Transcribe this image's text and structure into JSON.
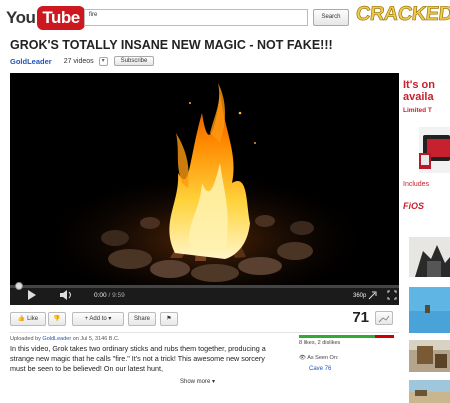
{
  "header": {
    "logo_you": "You",
    "logo_tube": "Tube",
    "search_value": "fire",
    "search_button": "Search",
    "cracked_logo": "CRACKED.com"
  },
  "video": {
    "title": "GROK'S TOTALLY INSANE NEW MAGIC - NOT FAKE!!!",
    "channel": "GoldLeader",
    "video_count": "27 videos",
    "subscribe": "Subscribe"
  },
  "player": {
    "current_time": "0:00",
    "duration": "/ 9:59",
    "quality": "360p",
    "progress_fraction": 0.0
  },
  "actions": {
    "like": "Like",
    "add_to": "+  Add to",
    "share": "Share",
    "views": "71"
  },
  "details": {
    "uploaded_prefix": "Uploaded by",
    "uploader": "GoldLeader",
    "uploaded_suffix": "on Jul 5, 3146 B.C.",
    "description": "In this video, Grok takes two ordinary sticks and rubs them together, producing a strange new magic that he calls \"fire.\" It's not a trick! This awesome new sorcery must be seen to be believed! On our latest hunt,",
    "show_more": "Show more",
    "likes": "8 likes, 2 dislikes",
    "like_fraction": 0.8,
    "seen_on": "As Seen On:",
    "seen_on_link": "Cave 76"
  },
  "ad": {
    "title_line1": "It's on",
    "title_line2": "availa",
    "subtitle": "Limited T",
    "includes": "Includes",
    "brand": "FiOS"
  },
  "colors": {
    "youtube_red": "#cc181e",
    "link_blue": "#2255bb",
    "verizon_red": "#c7202e",
    "player_bg": "#1b1b1b"
  }
}
